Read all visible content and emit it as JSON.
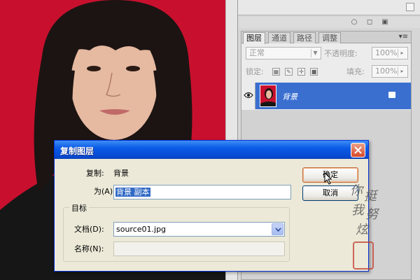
{
  "canvas": {
    "background_color": "#c8102e"
  },
  "layers_panel": {
    "tabs": [
      "图层",
      "通道",
      "路径",
      "调整"
    ],
    "active_tab": 0,
    "menu_icon": "panel-menu-icon",
    "blend_mode": "正常",
    "opacity_label": "不透明度:",
    "opacity_value": "100%",
    "lock_label": "锁定:",
    "fill_label": "填充:",
    "fill_value": "100%",
    "layer": {
      "name": "背景",
      "visible": true,
      "locked": true
    }
  },
  "dialog": {
    "title": "复制图层",
    "copy_label": "复制:",
    "copy_value": "背景",
    "as_label": "为(A):",
    "as_value": "背景 副本",
    "target_group_label": "目标",
    "document_label": "文档(D):",
    "document_value": "source01.jpg",
    "name_label": "名称(N):",
    "name_value": "",
    "ok_label": "确定",
    "cancel_label": "取消",
    "accent_color": "#0b5be6"
  },
  "watermark": {
    "characters": [
      "你",
      "挺",
      "我",
      "努",
      "炫"
    ]
  }
}
